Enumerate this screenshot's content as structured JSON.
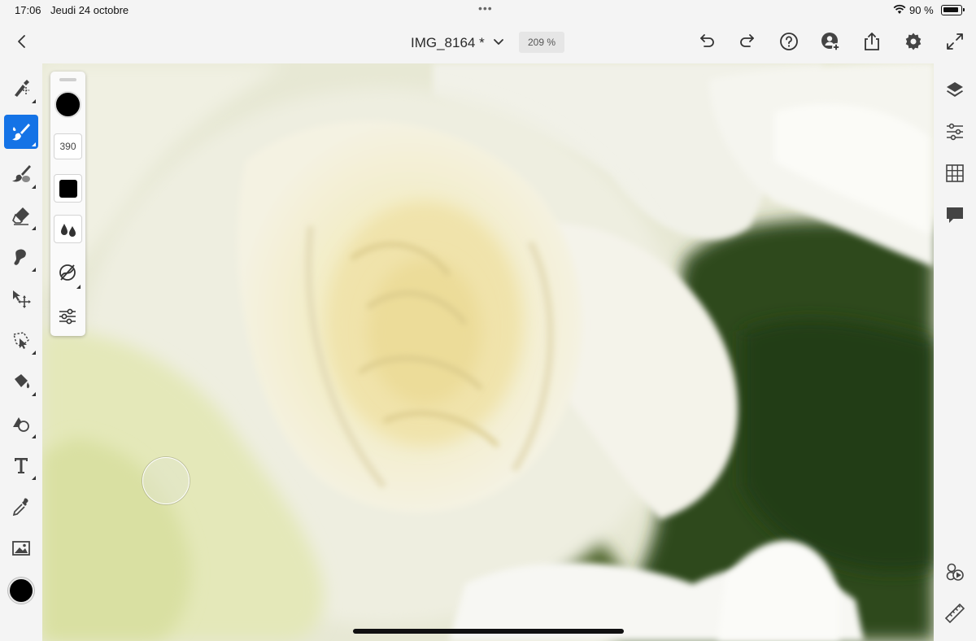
{
  "status_bar": {
    "time": "17:06",
    "date": "Jeudi 24 octobre",
    "multitask_dots": "•••",
    "battery_label": "90 %",
    "battery_level": 0.9,
    "wifi_icon": "wifi-icon"
  },
  "toolbar": {
    "back_icon": "chevron-left-icon",
    "document_title": "IMG_8164 *",
    "title_menu_icon": "chevron-down-icon",
    "zoom_level": "209 %",
    "actions": [
      "undo-icon",
      "redo-icon",
      "help-icon",
      "invite-icon",
      "share-icon",
      "settings-icon",
      "fullscreen-icon"
    ]
  },
  "left_tools": {
    "tools": [
      "brush-selection-tool",
      "paint-brush-tool",
      "smudge-tool",
      "eraser-tool",
      "healing-tool",
      "move-tool",
      "lasso-tool",
      "fill-tool",
      "shape-tool",
      "type-tool",
      "eyedropper-tool",
      "place-image-tool"
    ],
    "active_tool": "paint-brush-tool",
    "foreground_color": "#000000"
  },
  "brush_options": {
    "color": "#000000",
    "size": "390",
    "tip_icon": "square-tip-icon",
    "flow_icon": "drops-icon",
    "blend_icon": "blend-mode-icon",
    "settings_icon": "brush-settings-icon"
  },
  "right_panel": {
    "items": [
      "layers-icon",
      "adjustments-icon",
      "grid-icon",
      "comments-icon",
      "livestream-icon",
      "ruler-icon"
    ]
  },
  "colors": {
    "accent": "#1473e6",
    "chrome_background": "#f4f4f4",
    "foliage": "#2f4a1a",
    "petal_white": "#f3f3ea",
    "petal_cream": "#f1e8b8"
  }
}
